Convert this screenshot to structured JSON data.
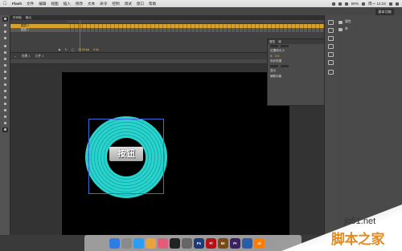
{
  "menubar": {
    "app_name": "Flash",
    "items": [
      "文件",
      "编辑",
      "视图",
      "插入",
      "修改",
      "文本",
      "命令",
      "控制",
      "调试",
      "窗口",
      "帮助"
    ],
    "battery": "50%",
    "time": "周一 12:22"
  },
  "workspace": {
    "essentials": "基本功能"
  },
  "timeline": {
    "tabs": [
      "时间轴",
      "输出"
    ],
    "layers": [
      "图层 2",
      "图层 1"
    ],
    "fps": "24.00 fps",
    "time": "0.0s"
  },
  "stage": {
    "breadcrumb": [
      "场景 1",
      "元件 1"
    ],
    "button_text": "按钮"
  },
  "properties_panel": {
    "tabs": [
      "属性",
      "库"
    ],
    "rows": [
      "位置和大小",
      "色彩效果",
      "显示",
      "辅助功能"
    ],
    "x_value": "0.0"
  },
  "right_panel": {
    "items": [
      "属性",
      "库"
    ]
  },
  "dock": {
    "apps": [
      "Finder",
      "Launchpad",
      "Safari",
      "Chrome",
      "Photos",
      "QQ",
      "Preview",
      "PS",
      "Fl",
      "Br",
      "Pr",
      "Word",
      "Ai",
      "Trash"
    ],
    "colors": [
      "#2f7de1",
      "#8a8a8a",
      "#2d9cf4",
      "#e8a33c",
      "#e25b7a",
      "#222222",
      "#666666",
      "#1b3b7a",
      "#b31217",
      "#7a4a14",
      "#3b1f5e",
      "#2a5caa",
      "#ff7c00",
      "#9a9a9a"
    ]
  },
  "watermark": {
    "url": "jb51.net",
    "text": "脚本之家"
  },
  "colors": {
    "ring": "#28d4cd",
    "timeline_selected": "#d6a22b",
    "playhead": "#e03b3b",
    "watermark": "#e58a1f"
  }
}
